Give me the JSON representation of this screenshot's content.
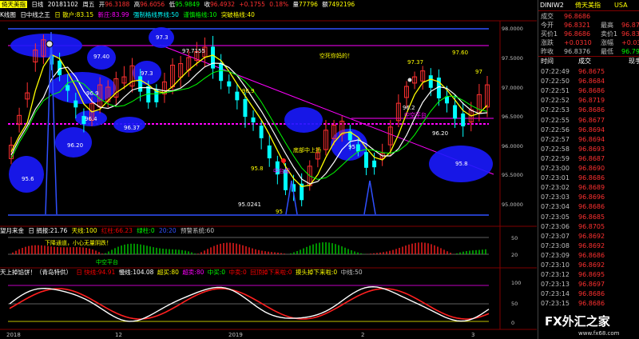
{
  "header": {
    "symbol": "倚天美指",
    "period": "日线",
    "date": "20181102",
    "weekday": "周五",
    "open_label": "开",
    "open": "96.3188",
    "high_label": "高",
    "high": "96.6056",
    "low_label": "低",
    "low": "95.9849",
    "close_label": "收",
    "close": "96.4932",
    "change": "+0.1755",
    "change_pct": "0.18%",
    "volume_label": "量",
    "volume": "77796",
    "amount_label": "额",
    "amount": "7492196"
  },
  "main_indicator": {
    "name": "K线图",
    "items": [
      {
        "text": "日中线之王",
        "color": "#ffffff"
      },
      {
        "text": "日 散户:83.15",
        "color": "#ffff00"
      },
      {
        "text": "新庄:83.99",
        "color": "#ff00ff"
      },
      {
        "text": "强制格线界线:50",
        "color": "#00ffff"
      },
      {
        "text": "谨慎格线:10",
        "color": "#00ff00"
      },
      {
        "text": "突破格线:40",
        "color": "#ffff00"
      }
    ]
  },
  "chart_labels": [
    "97.3",
    "97.40",
    "97.7155",
    "97.3",
    "96.9",
    "96.4",
    "96.37",
    "96.20",
    "95.6",
    "96.9",
    "95.8",
    "95.0241",
    "95",
    "空死你妈的！",
    "97.37",
    "97.60",
    "97",
    "96.2",
    "96.20",
    "95.8",
    "95",
    "底部中上扬",
    "中台起",
    "中空平台"
  ],
  "price_axis": [
    "98.0000",
    "97.5000",
    "97.0000",
    "96.5000",
    "96.0000",
    "95.5000",
    "95.0000"
  ],
  "indicator2": {
    "title": "望月来金",
    "items": [
      {
        "text": "日 捐报:21.76",
        "color": "#ffffff"
      },
      {
        "text": "天线:100",
        "color": "#ffff00"
      },
      {
        "text": "红柱:66.23",
        "color": "#ff0000"
      },
      {
        "text": "绿柱:0",
        "color": "#00ff00"
      },
      {
        "text": "20:20",
        "color": "#0000ff"
      },
      {
        "text": "预警系统:60",
        "color": "#c0c0c0"
      }
    ],
    "note": "下降通道，小心无量阴跌！",
    "note2": "中空平台",
    "axis": [
      "50",
      "20"
    ]
  },
  "indicator3": {
    "title": "天上掉馅饼！（青岛特供）",
    "items": [
      {
        "text": "日 快线:94.91",
        "color": "#ff0000"
      },
      {
        "text": "慢线:104.08",
        "color": "#ffffff"
      },
      {
        "text": "超买:80",
        "color": "#ffff00"
      },
      {
        "text": "超卖:80",
        "color": "#ff00ff"
      },
      {
        "text": "中买:0",
        "color": "#00ff00"
      },
      {
        "text": "中卖:0",
        "color": "#ff0000"
      },
      {
        "text": "回顶掉下来啦:0",
        "color": "#ff0000"
      },
      {
        "text": "摸头掉下来啦:0",
        "color": "#ffff00"
      },
      {
        "text": "中线:50",
        "color": "#c0c0c0"
      }
    ],
    "axis": [
      "100",
      "50",
      "0"
    ]
  },
  "time_axis": [
    "2018",
    "12",
    "2019",
    "2",
    "3"
  ],
  "quote_panel": {
    "code": "DINIW2",
    "name": "倚天美指",
    "market": "USA",
    "rows": [
      {
        "l": "成交",
        "v": "96.8686",
        "l2": "",
        "v2": ""
      },
      {
        "l": "今开",
        "v": "96.8321",
        "l2": "最高",
        "v2": "96.87"
      },
      {
        "l": "买价1",
        "v": "96.8686",
        "l2": "卖价1",
        "v2": "96.83"
      },
      {
        "l": "涨跌",
        "v": "+0.0310",
        "l2": "涨幅",
        "v2": "+0.03"
      },
      {
        "l": "昨收",
        "v": "96.8376",
        "l2": "最低",
        "v2": "96.79"
      }
    ],
    "ticks_header": {
      "time": "时间",
      "price": "成交",
      "vol": "现手"
    },
    "ticks": [
      {
        "time": "07:22:49",
        "price": "96.8675"
      },
      {
        "time": "07:22:50",
        "price": "96.8684"
      },
      {
        "time": "07:22:51",
        "price": "96.8686"
      },
      {
        "time": "07:22:52",
        "price": "96.8719"
      },
      {
        "time": "07:22:53",
        "price": "96.8686"
      },
      {
        "time": "07:22:55",
        "price": "96.8677"
      },
      {
        "time": "07:22:56",
        "price": "96.8694"
      },
      {
        "time": "07:22:57",
        "price": "96.8694"
      },
      {
        "time": "07:22:58",
        "price": "96.8693"
      },
      {
        "time": "07:22:59",
        "price": "96.8687"
      },
      {
        "time": "07:23:00",
        "price": "96.8690"
      },
      {
        "time": "07:23:01",
        "price": "96.8686"
      },
      {
        "time": "07:23:02",
        "price": "96.8689"
      },
      {
        "time": "07:23:03",
        "price": "96.8696"
      },
      {
        "time": "07:23:04",
        "price": "96.8686"
      },
      {
        "time": "07:23:05",
        "price": "96.8685"
      },
      {
        "time": "07:23:06",
        "price": "96.8705"
      },
      {
        "time": "07:23:07",
        "price": "96.8692"
      },
      {
        "time": "07:23:08",
        "price": "96.8692"
      },
      {
        "time": "07:23:09",
        "price": "96.8686"
      },
      {
        "time": "07:23:10",
        "price": "96.8692"
      },
      {
        "time": "07:23:12",
        "price": "96.8695"
      },
      {
        "time": "07:23:13",
        "price": "96.8697"
      },
      {
        "time": "07:23:14",
        "price": "96.8686"
      },
      {
        "time": "07:23:15",
        "price": "96.8686"
      }
    ],
    "watermark": "FX外汇之家",
    "watermark_url": "www.fx68.com"
  },
  "colors": {
    "up": "#ff3030",
    "down": "#00ffff",
    "panel_value": "#ff3030",
    "grid": "#800000"
  }
}
